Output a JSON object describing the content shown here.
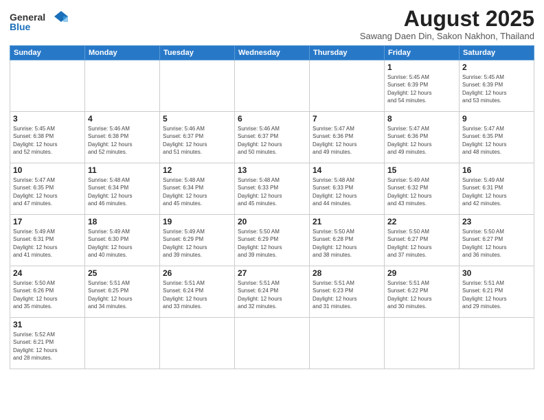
{
  "header": {
    "logo_general": "General",
    "logo_blue": "Blue",
    "month_title": "August 2025",
    "subtitle": "Sawang Daen Din, Sakon Nakhon, Thailand"
  },
  "days_of_week": [
    "Sunday",
    "Monday",
    "Tuesday",
    "Wednesday",
    "Thursday",
    "Friday",
    "Saturday"
  ],
  "weeks": [
    [
      {
        "day": "",
        "info": ""
      },
      {
        "day": "",
        "info": ""
      },
      {
        "day": "",
        "info": ""
      },
      {
        "day": "",
        "info": ""
      },
      {
        "day": "",
        "info": ""
      },
      {
        "day": "1",
        "info": "Sunrise: 5:45 AM\nSunset: 6:39 PM\nDaylight: 12 hours\nand 54 minutes."
      },
      {
        "day": "2",
        "info": "Sunrise: 5:45 AM\nSunset: 6:39 PM\nDaylight: 12 hours\nand 53 minutes."
      }
    ],
    [
      {
        "day": "3",
        "info": "Sunrise: 5:45 AM\nSunset: 6:38 PM\nDaylight: 12 hours\nand 52 minutes."
      },
      {
        "day": "4",
        "info": "Sunrise: 5:46 AM\nSunset: 6:38 PM\nDaylight: 12 hours\nand 52 minutes."
      },
      {
        "day": "5",
        "info": "Sunrise: 5:46 AM\nSunset: 6:37 PM\nDaylight: 12 hours\nand 51 minutes."
      },
      {
        "day": "6",
        "info": "Sunrise: 5:46 AM\nSunset: 6:37 PM\nDaylight: 12 hours\nand 50 minutes."
      },
      {
        "day": "7",
        "info": "Sunrise: 5:47 AM\nSunset: 6:36 PM\nDaylight: 12 hours\nand 49 minutes."
      },
      {
        "day": "8",
        "info": "Sunrise: 5:47 AM\nSunset: 6:36 PM\nDaylight: 12 hours\nand 49 minutes."
      },
      {
        "day": "9",
        "info": "Sunrise: 5:47 AM\nSunset: 6:35 PM\nDaylight: 12 hours\nand 48 minutes."
      }
    ],
    [
      {
        "day": "10",
        "info": "Sunrise: 5:47 AM\nSunset: 6:35 PM\nDaylight: 12 hours\nand 47 minutes."
      },
      {
        "day": "11",
        "info": "Sunrise: 5:48 AM\nSunset: 6:34 PM\nDaylight: 12 hours\nand 46 minutes."
      },
      {
        "day": "12",
        "info": "Sunrise: 5:48 AM\nSunset: 6:34 PM\nDaylight: 12 hours\nand 45 minutes."
      },
      {
        "day": "13",
        "info": "Sunrise: 5:48 AM\nSunset: 6:33 PM\nDaylight: 12 hours\nand 45 minutes."
      },
      {
        "day": "14",
        "info": "Sunrise: 5:48 AM\nSunset: 6:33 PM\nDaylight: 12 hours\nand 44 minutes."
      },
      {
        "day": "15",
        "info": "Sunrise: 5:49 AM\nSunset: 6:32 PM\nDaylight: 12 hours\nand 43 minutes."
      },
      {
        "day": "16",
        "info": "Sunrise: 5:49 AM\nSunset: 6:31 PM\nDaylight: 12 hours\nand 42 minutes."
      }
    ],
    [
      {
        "day": "17",
        "info": "Sunrise: 5:49 AM\nSunset: 6:31 PM\nDaylight: 12 hours\nand 41 minutes."
      },
      {
        "day": "18",
        "info": "Sunrise: 5:49 AM\nSunset: 6:30 PM\nDaylight: 12 hours\nand 40 minutes."
      },
      {
        "day": "19",
        "info": "Sunrise: 5:49 AM\nSunset: 6:29 PM\nDaylight: 12 hours\nand 39 minutes."
      },
      {
        "day": "20",
        "info": "Sunrise: 5:50 AM\nSunset: 6:29 PM\nDaylight: 12 hours\nand 39 minutes."
      },
      {
        "day": "21",
        "info": "Sunrise: 5:50 AM\nSunset: 6:28 PM\nDaylight: 12 hours\nand 38 minutes."
      },
      {
        "day": "22",
        "info": "Sunrise: 5:50 AM\nSunset: 6:27 PM\nDaylight: 12 hours\nand 37 minutes."
      },
      {
        "day": "23",
        "info": "Sunrise: 5:50 AM\nSunset: 6:27 PM\nDaylight: 12 hours\nand 36 minutes."
      }
    ],
    [
      {
        "day": "24",
        "info": "Sunrise: 5:50 AM\nSunset: 6:26 PM\nDaylight: 12 hours\nand 35 minutes."
      },
      {
        "day": "25",
        "info": "Sunrise: 5:51 AM\nSunset: 6:25 PM\nDaylight: 12 hours\nand 34 minutes."
      },
      {
        "day": "26",
        "info": "Sunrise: 5:51 AM\nSunset: 6:24 PM\nDaylight: 12 hours\nand 33 minutes."
      },
      {
        "day": "27",
        "info": "Sunrise: 5:51 AM\nSunset: 6:24 PM\nDaylight: 12 hours\nand 32 minutes."
      },
      {
        "day": "28",
        "info": "Sunrise: 5:51 AM\nSunset: 6:23 PM\nDaylight: 12 hours\nand 31 minutes."
      },
      {
        "day": "29",
        "info": "Sunrise: 5:51 AM\nSunset: 6:22 PM\nDaylight: 12 hours\nand 30 minutes."
      },
      {
        "day": "30",
        "info": "Sunrise: 5:51 AM\nSunset: 6:21 PM\nDaylight: 12 hours\nand 29 minutes."
      }
    ],
    [
      {
        "day": "31",
        "info": "Sunrise: 5:52 AM\nSunset: 6:21 PM\nDaylight: 12 hours\nand 28 minutes."
      },
      {
        "day": "",
        "info": ""
      },
      {
        "day": "",
        "info": ""
      },
      {
        "day": "",
        "info": ""
      },
      {
        "day": "",
        "info": ""
      },
      {
        "day": "",
        "info": ""
      },
      {
        "day": "",
        "info": ""
      }
    ]
  ]
}
